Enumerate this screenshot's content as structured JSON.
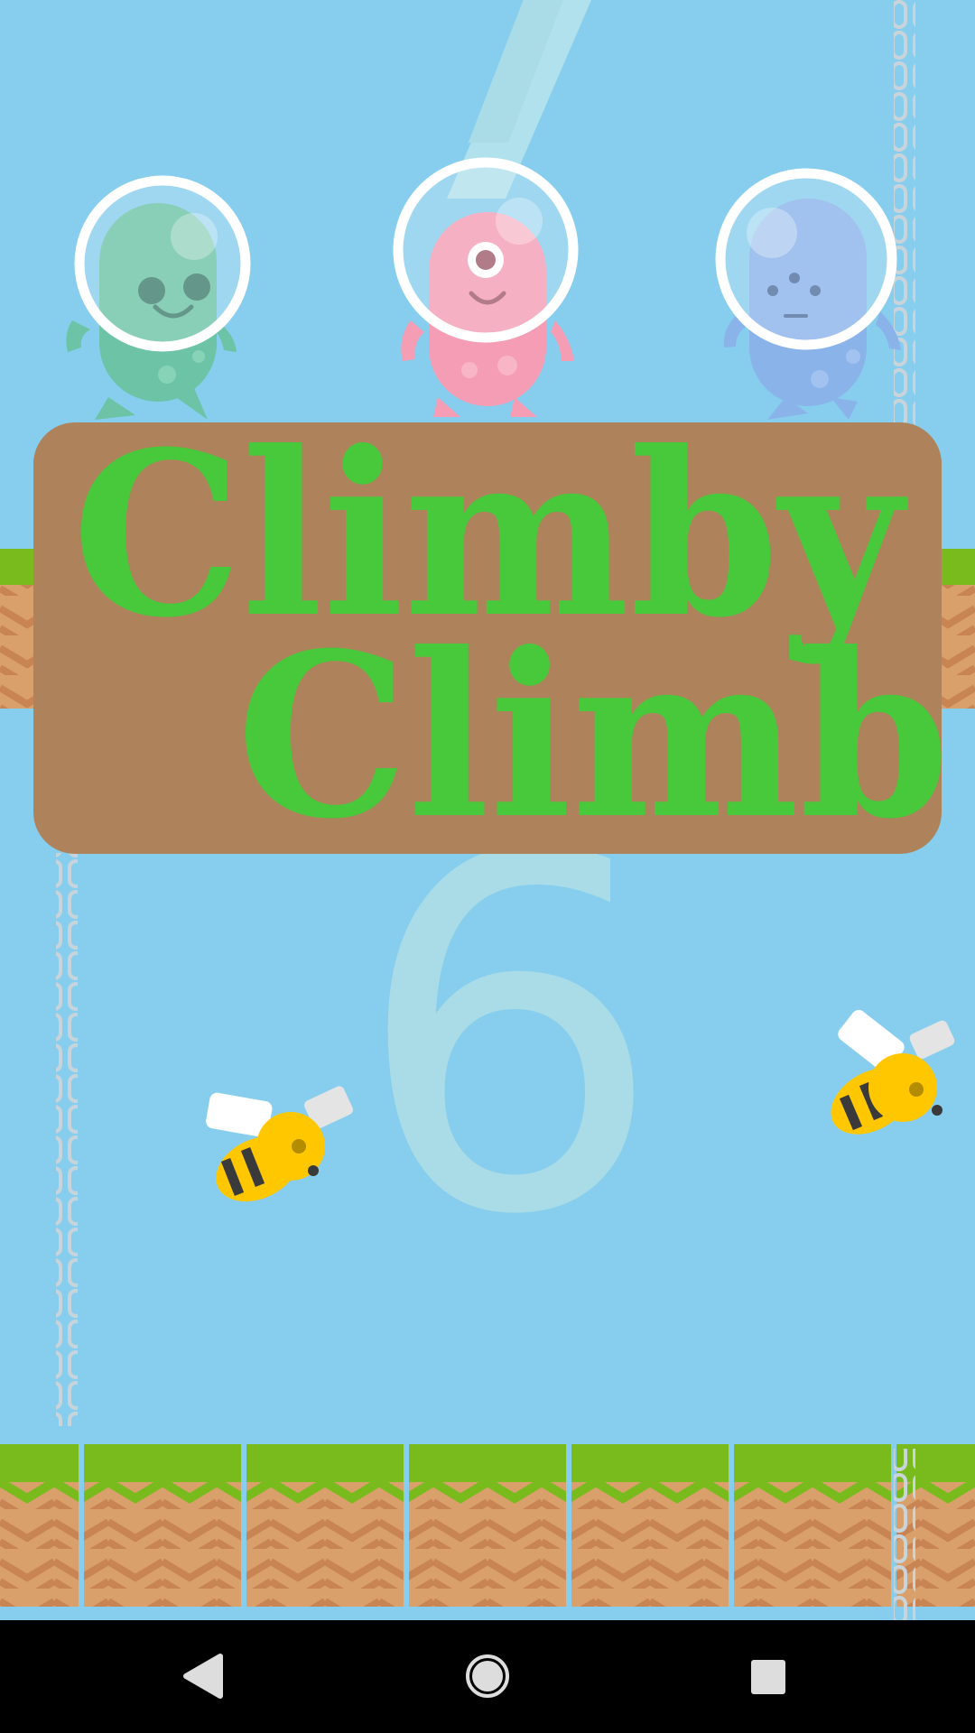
{
  "title": {
    "line1": "Climby",
    "line2": "Climb",
    "text_color": "#48C83B",
    "panel_color": "#AE835B"
  },
  "score": {
    "top_digit": "7",
    "current": "6",
    "color": "#A9DCE6"
  },
  "colors": {
    "sky": "#87CEEE",
    "grass": "#79BB1D",
    "dirt": "#C98A58",
    "bee_yellow": "#FFC700"
  },
  "characters": [
    {
      "name": "green-alien",
      "color": "#6CC3A6"
    },
    {
      "name": "pink-alien",
      "color": "#F49DB4"
    },
    {
      "name": "blue-alien",
      "color": "#8AB3EA"
    }
  ],
  "navbar": {
    "back_icon": "back-triangle-icon",
    "home_icon": "home-circle-icon",
    "recents_icon": "recents-square-icon"
  }
}
